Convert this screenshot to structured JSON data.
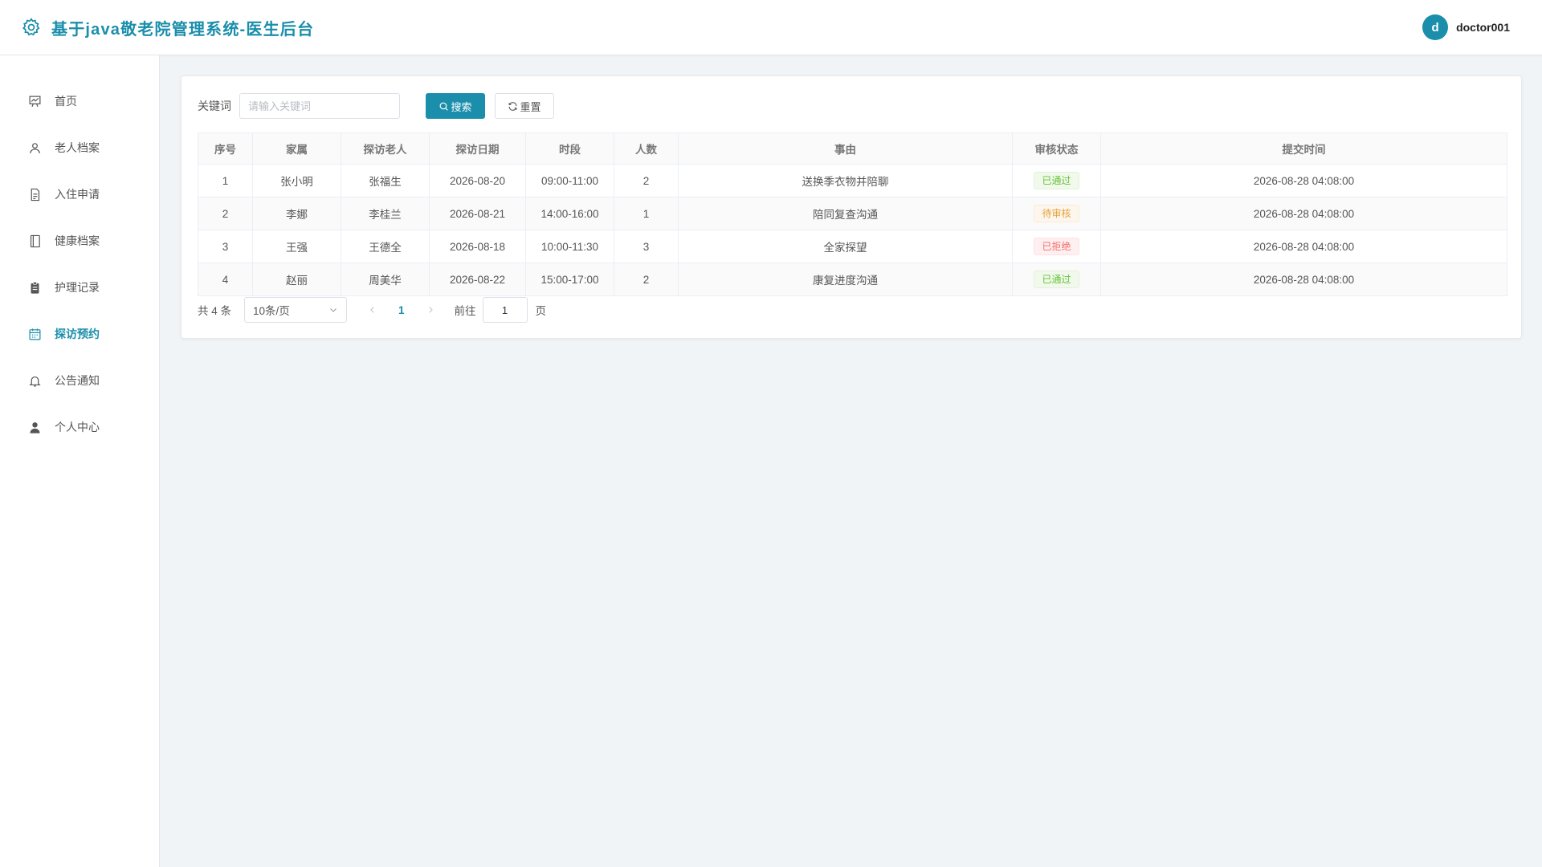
{
  "header": {
    "title": "基于java敬老院管理系统-医生后台",
    "logo_icon": "gear-icon",
    "avatar_letter": "d",
    "username": "doctor001",
    "accent_color": "#1a8eab"
  },
  "sidebar": {
    "items": [
      {
        "label": "首页",
        "icon": "chart-board-icon",
        "active": false
      },
      {
        "label": "老人档案",
        "icon": "user-outline-icon",
        "active": false
      },
      {
        "label": "入住申请",
        "icon": "document-icon",
        "active": false
      },
      {
        "label": "健康档案",
        "icon": "notebook-icon",
        "active": false
      },
      {
        "label": "护理记录",
        "icon": "clipboard-icon",
        "active": false
      },
      {
        "label": "探访预约",
        "icon": "calendar-icon",
        "active": true
      },
      {
        "label": "公告通知",
        "icon": "bell-icon",
        "active": false
      },
      {
        "label": "个人中心",
        "icon": "user-solid-icon",
        "active": false
      }
    ]
  },
  "search": {
    "label": "关键词",
    "placeholder": "请输入关键词",
    "value": "",
    "search_button": "搜索",
    "reset_button": "重置"
  },
  "table": {
    "columns": [
      "序号",
      "家属",
      "探访老人",
      "探访日期",
      "时段",
      "人数",
      "事由",
      "审核状态",
      "提交时间"
    ],
    "rows": [
      {
        "index": "1",
        "family": "张小明",
        "elder": "张福生",
        "date": "2026-08-20",
        "slot": "09:00-11:00",
        "count": "2",
        "reason": "送换季衣物并陪聊",
        "status": "已通过",
        "status_type": "pass",
        "submitted": "2026-08-28 04:08:00"
      },
      {
        "index": "2",
        "family": "李娜",
        "elder": "李桂兰",
        "date": "2026-08-21",
        "slot": "14:00-16:00",
        "count": "1",
        "reason": "陪同复查沟通",
        "status": "待审核",
        "status_type": "wait",
        "submitted": "2026-08-28 04:08:00"
      },
      {
        "index": "3",
        "family": "王强",
        "elder": "王德全",
        "date": "2026-08-18",
        "slot": "10:00-11:30",
        "count": "3",
        "reason": "全家探望",
        "status": "已拒绝",
        "status_type": "reject",
        "submitted": "2026-08-28 04:08:00"
      },
      {
        "index": "4",
        "family": "赵丽",
        "elder": "周美华",
        "date": "2026-08-22",
        "slot": "15:00-17:00",
        "count": "2",
        "reason": "康复进度沟通",
        "status": "已通过",
        "status_type": "pass",
        "submitted": "2026-08-28 04:08:00"
      }
    ]
  },
  "pagination": {
    "total_text": "共 4 条",
    "page_size": "10条/页",
    "current_page": "1",
    "goto_label": "前往",
    "goto_value": "1",
    "page_unit": "页"
  }
}
